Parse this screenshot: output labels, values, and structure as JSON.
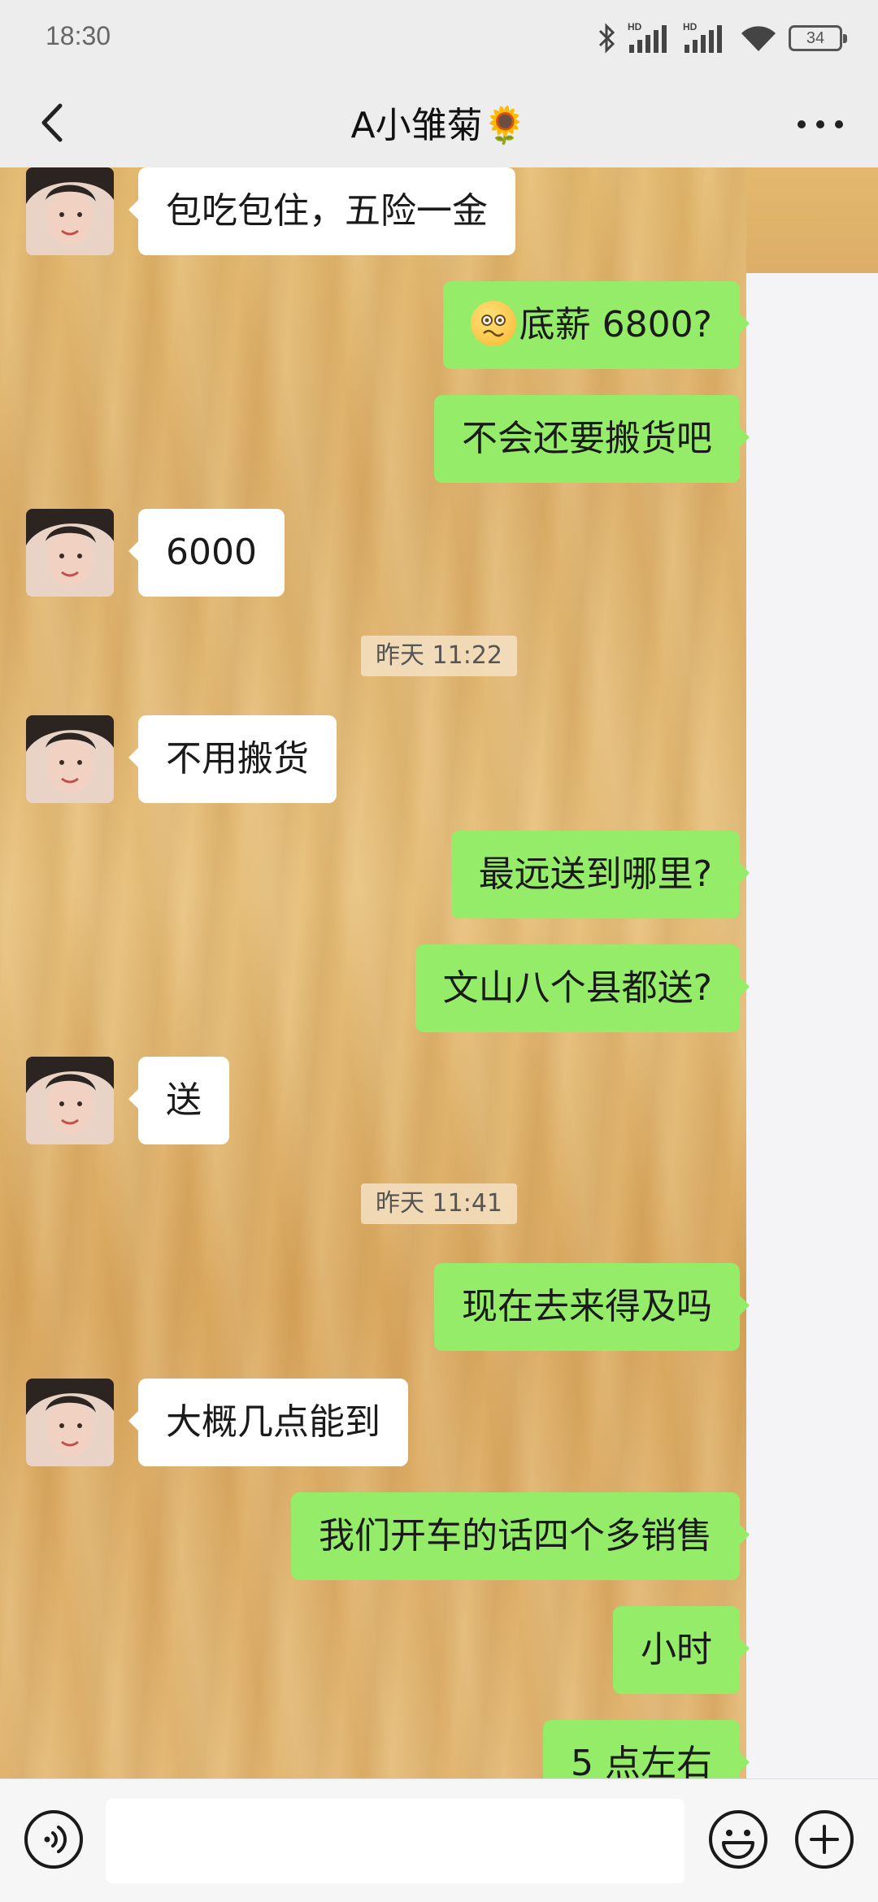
{
  "status_bar": {
    "time": "18:30",
    "battery_level": "34",
    "icons": [
      "bluetooth-icon",
      "hd-signal-icon",
      "hd-signal-icon",
      "wifi-icon",
      "battery-icon"
    ]
  },
  "header": {
    "title": "A小雏菊🌻",
    "back_icon": "chevron-left-icon",
    "more_icon": "more-dots-icon"
  },
  "colors": {
    "sent_bubble": "#95ec69",
    "received_bubble": "#ffffff",
    "bar_background": "#ededed"
  },
  "messages": [
    {
      "side": "left",
      "text": "包吃包住，五险一金"
    },
    {
      "side": "right",
      "text": "底薪 6800?",
      "emoji": "woozy-face"
    },
    {
      "side": "right",
      "text": "不会还要搬货吧"
    },
    {
      "side": "left",
      "text": "6000"
    },
    {
      "type": "time",
      "text": "昨天 11:22"
    },
    {
      "side": "left",
      "text": "不用搬货"
    },
    {
      "side": "right",
      "text": "最远送到哪里?"
    },
    {
      "side": "right",
      "text": "文山八个县都送?"
    },
    {
      "side": "left",
      "text": "送"
    },
    {
      "type": "time",
      "text": "昨天 11:41"
    },
    {
      "side": "right",
      "text": "现在去来得及吗"
    },
    {
      "side": "left",
      "text": "大概几点能到"
    },
    {
      "side": "right",
      "text": "我们开车的话四个多销售"
    },
    {
      "side": "right",
      "text": "小时"
    },
    {
      "side": "right",
      "text": "5 点左右"
    }
  ],
  "input_bar": {
    "value": "",
    "icons": [
      "voice-icon",
      "emoji-icon",
      "plus-icon"
    ]
  }
}
